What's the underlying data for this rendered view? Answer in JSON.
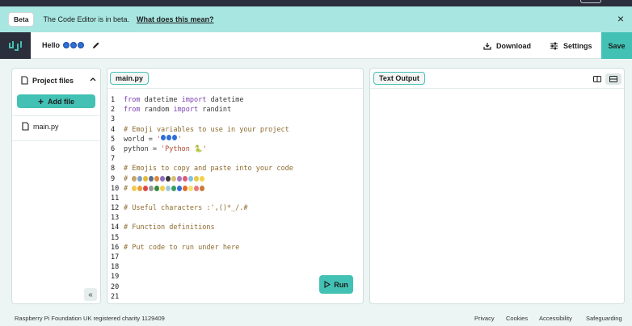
{
  "beta_bar": {
    "badge": "Beta",
    "message": "The Code Editor is in beta.",
    "link": "What does this mean?",
    "close": "×"
  },
  "header": {
    "project_name": "Hello",
    "download_label": "Download",
    "settings_label": "Settings",
    "save_label": "Save"
  },
  "sidebar": {
    "title": "Project files",
    "add_file_label": "Add file",
    "files": [
      "main.py"
    ],
    "collapse_glyph": "«"
  },
  "editor": {
    "tab_label": "main.py",
    "run_label": "Run",
    "line_numbers": [
      "1",
      "2",
      "3",
      "4",
      "5",
      "6",
      "7",
      "8",
      "9",
      "10",
      "11",
      "12",
      "13",
      "14",
      "15",
      "16",
      "17",
      "18",
      "19",
      "20",
      "21"
    ],
    "lines": {
      "l1": {
        "kw1": "from",
        "mid": " datetime ",
        "kw2": "import",
        "end": " datetime"
      },
      "l2": {
        "kw1": "from",
        "mid": " random ",
        "kw2": "import",
        "end": " randint"
      },
      "l4": "# Emoji variables to use in your project",
      "l5_pre": "world = ",
      "l5_str_open": "'",
      "l5_str_close": "'",
      "l6_pre": "python = ",
      "l6_str": "'Python 🐍'",
      "l8": "# Emojis to copy and paste into your code",
      "l9": "# ",
      "l10": "# ",
      "l12": "# Useful characters :',()*_/.#",
      "l14": "# Function definitions",
      "l16": "# Put code to run under here"
    }
  },
  "output": {
    "tab_label": "Text Output"
  },
  "footer": {
    "charity": "Raspberry Pi Foundation UK registered charity 1129409",
    "privacy": "Privacy",
    "cookies": "Cookies",
    "accessibility": "Accessibility",
    "safeguarding": "Safeguarding"
  },
  "colors": {
    "accent": "#42c1b4",
    "beta_bg": "#a8e6e1",
    "page_bg": "#ecf5f4",
    "dark": "#2b2e3b"
  },
  "icons": [
    "logo-icon",
    "pencil-icon",
    "download-icon",
    "settings-icon",
    "file-icon",
    "chevron-up-icon",
    "play-icon",
    "split-view-icon",
    "stacked-view-icon"
  ]
}
